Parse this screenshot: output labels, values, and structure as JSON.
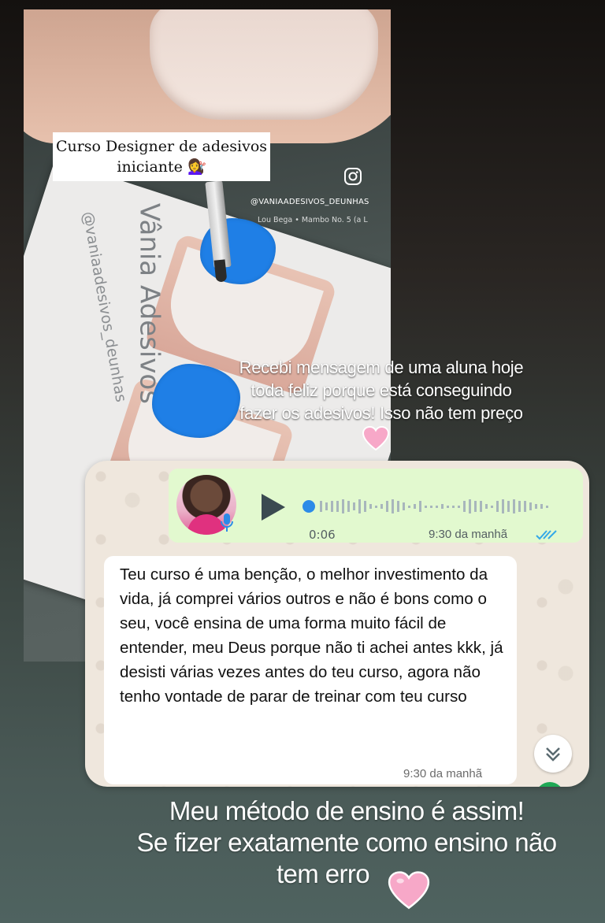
{
  "video": {
    "caption_line1": "Curso Designer de adesivos",
    "caption_line2": "iniciante 💇‍♀️",
    "card_handle": "@vaniaadesivos_deunhas",
    "card_brand": "Vânia Adesivos",
    "ig_handle": "@VANIAADESIVOS_DEUNHAS",
    "music": "Lou Bega • Mambo No. 5 (a L"
  },
  "overlay_text": "Recebi mensagem de uma aluna hoje toda feliz porque está conseguindo fazer os adesivos! Isso não tem preço",
  "whatsapp": {
    "voice_duration": "0:06",
    "voice_time": "9:30 da manhã",
    "message": "Teu curso é uma benção, o melhor investimento da vida, já comprei vários outros e não é bons como o seu, você ensina de uma forma muito fácil de entender, meu Deus porque não ti achei antes kkk, já desisti várias vezes antes do teu curso, agora não tenho vontade de parar de treinar com teu curso",
    "message_time": "9:30 da manhã"
  },
  "bottom_text": {
    "line1": "Meu método de ensino é assim!",
    "line2": "Se fizer exatamente como ensino não",
    "line3": "tem erro"
  },
  "colors": {
    "accent_blue": "#1f7fe6",
    "whatsapp_voice_bg": "#e2f9cf",
    "heart": "#f7a8c8"
  }
}
